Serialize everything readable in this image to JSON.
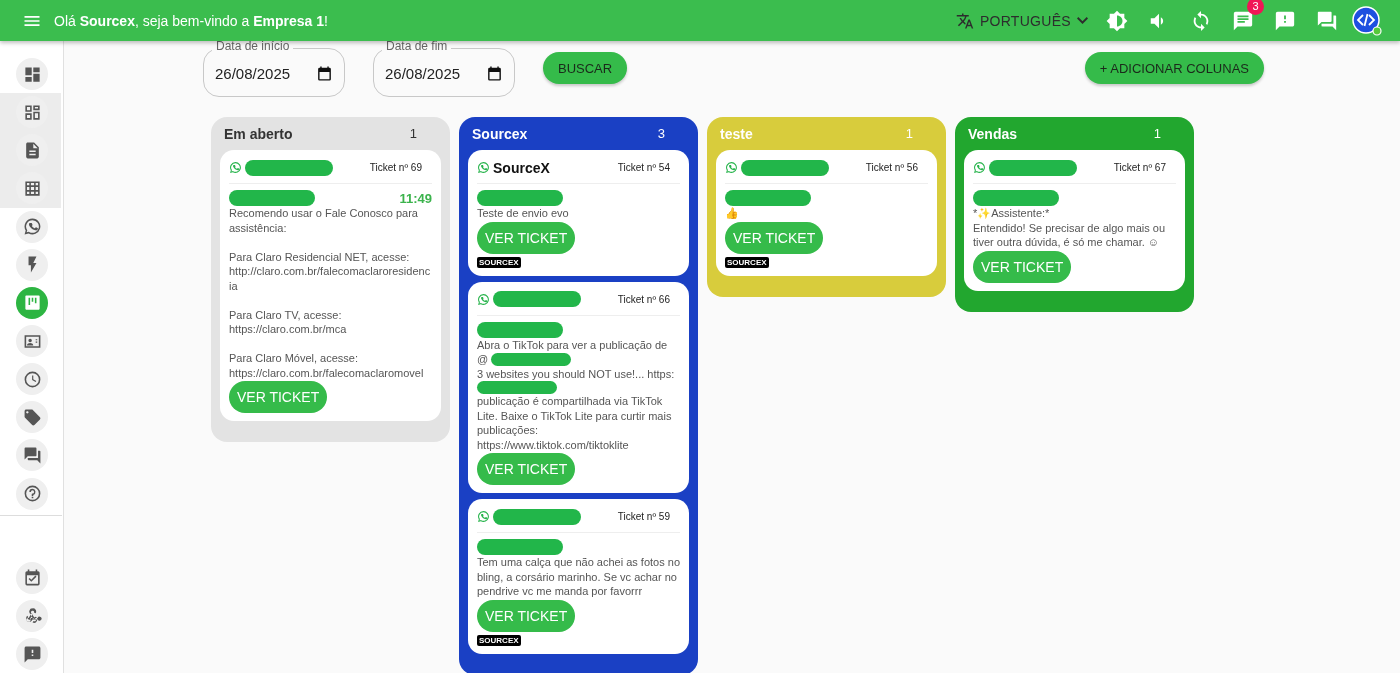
{
  "top_bar": {
    "greeting": "Olá **Sourcex**, seja bem-vindo a **Empresa 1**!",
    "language": "PORTUGUÊS",
    "chat_badge": "3"
  },
  "sidebar": {
    "items": [
      {
        "kind": "main",
        "selected": false
      },
      {
        "kind": "sub",
        "selected": false
      },
      {
        "kind": "sub",
        "selected": false
      },
      {
        "kind": "sub",
        "selected": false
      },
      {
        "kind": "main",
        "selected": false
      },
      {
        "kind": "main",
        "selected": false
      },
      {
        "kind": "main",
        "selected": true
      },
      {
        "kind": "main",
        "selected": false
      },
      {
        "kind": "main",
        "selected": false
      },
      {
        "kind": "main",
        "selected": false
      },
      {
        "kind": "main",
        "selected": false
      },
      {
        "kind": "main",
        "selected": false
      },
      {
        "kind": "bottom",
        "selected": false
      },
      {
        "kind": "bottom",
        "selected": false
      },
      {
        "kind": "bottom",
        "selected": false
      }
    ]
  },
  "filters": {
    "start": {
      "label": "Data de início",
      "value": "26/08/2025"
    },
    "end": {
      "label": "Data de fim",
      "value": "26/08/2025"
    },
    "search_button": "BUSCAR",
    "add_columns_button": "+ ADICIONAR COLUNAS"
  },
  "columns": [
    {
      "title": "Em aberto",
      "count": "1",
      "color": "#e3e3e3",
      "cards": [
        {
          "ticket": "Ticket nº 69",
          "time": "11:49",
          "message": [
            {
              "kind": "text",
              "text": "Recomendo usar o Fale Conosco para assistência:\n\nPara Claro Residencial NET, acesse: http://claro.com.br/falecomaclaroresidencia\n\nPara Claro TV, acesse: https://claro.com.br/mca\n\nPara Claro Móvel, acesse: https://claro.com.br/falecomaclaromovel"
            }
          ],
          "button": "VER TICKET"
        }
      ]
    },
    {
      "title": "Sourcex",
      "count": "3",
      "color": "#1a40c4",
      "cards": [
        {
          "title": "SourceX",
          "ticket": "Ticket nº 54",
          "message": [
            {
              "kind": "text",
              "text": "Teste de envio evo"
            }
          ],
          "button": "VER TICKET",
          "tag": "SOURCEX"
        },
        {
          "ticket": "Ticket nº 66",
          "message": [
            {
              "kind": "text",
              "text": "Abra o TikTok para ver a publicação de"
            },
            {
              "kind": "text",
              "text": "@"
            },
            {
              "kind": "redacted"
            },
            {
              "kind": "text",
              "text": "3 websites you should"
            },
            {
              "kind": "text",
              "text": "NOT use!..."
            },
            {
              "kind": "text",
              "text": "https:"
            },
            {
              "kind": "redacted"
            },
            {
              "kind": "text",
              "text": "publicação é compartilhada via TikTok Lite. Baixe o TikTok Lite para curtir mais publicações: https://www.tiktok.com/tiktoklite"
            }
          ],
          "button": "VER TICKET"
        },
        {
          "ticket": "Ticket nº 59",
          "message": [
            {
              "kind": "text",
              "text": "Tem uma calça que não achei as fotos no bling, a corsário marinho. Se vc achar no pendrive vc me manda por favorrr"
            }
          ],
          "button": "VER TICKET",
          "tag": "SOURCEX"
        }
      ]
    },
    {
      "title": "teste",
      "count": "1",
      "color": "#d8cc3c",
      "cards": [
        {
          "ticket": "Ticket nº 56",
          "message": [
            {
              "kind": "text",
              "text": "👍"
            }
          ],
          "button": "VER TICKET",
          "tag": "SOURCEX"
        }
      ]
    },
    {
      "title": "Vendas",
      "count": "1",
      "color": "#22a72f",
      "cards": [
        {
          "ticket": "Ticket nº 67",
          "message": [
            {
              "kind": "text",
              "text": "*✨Assistente:*\nEntendido! Se precisar de algo mais ou tiver outra dúvida, é só me chamar. ☺"
            }
          ],
          "button": "VER TICKET"
        }
      ]
    }
  ]
}
